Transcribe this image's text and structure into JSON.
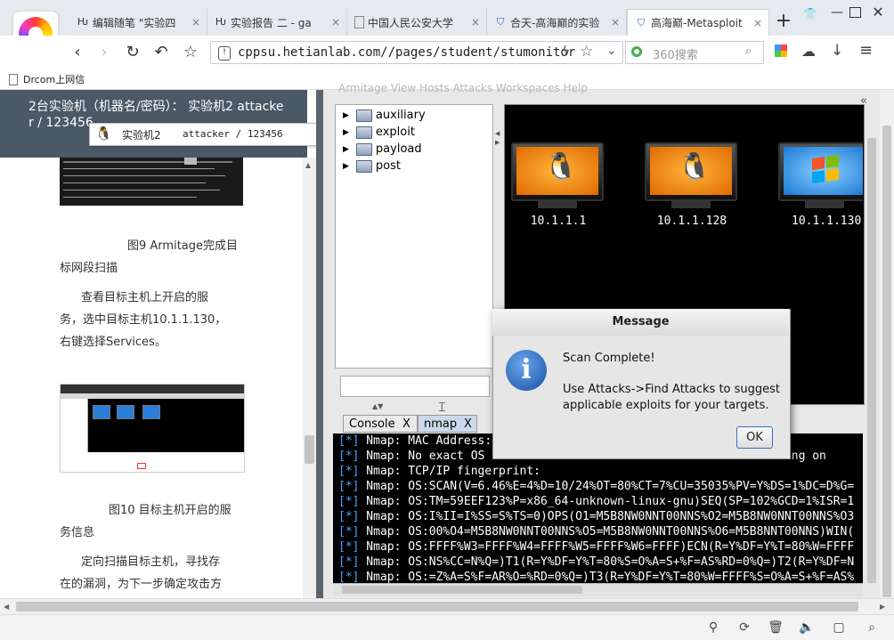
{
  "browser": {
    "tabs": [
      {
        "label": "编辑随笔 \"实验四",
        "icon": "h-logo-icon"
      },
      {
        "label": "实验报告 二 - ga",
        "icon": "h-logo-icon"
      },
      {
        "label": "中国人民公安大学",
        "icon": "page-icon"
      },
      {
        "label": "合天-高海巅的实验",
        "icon": "shield-icon"
      },
      {
        "label": "高海巅-Metasploit",
        "icon": "shield-icon"
      }
    ],
    "close_glyph": "×",
    "new_tab": "+",
    "url": "cppsu.hetianlab.com//pages/student/stumonitor",
    "search_placeholder": "360搜索",
    "bookmark": "Drcom上网信"
  },
  "doc": {
    "header_line1": "2台实验机（机器名/密码）： 实验机2    attacke",
    "header_line2": "r / 123456",
    "caption9_line1": "图9 Armitage完成目",
    "caption9_line2": "标网段扫描",
    "para1_line1": "查看目标主机上开启的服",
    "para1_line2": "务，选中目标主机10.1.1.130，",
    "para1_line3": "右键选择Services。",
    "caption10_line1": "图10 目标主机开启的服",
    "caption10_line2": "务信息",
    "para2_line1": "定向扫描目标主机，寻找存",
    "para2_line2": "在的漏洞，为下一步确定攻击方"
  },
  "popup": {
    "machine": "实验机2",
    "creds": "attacker / 123456"
  },
  "armitage": {
    "menu_faded": "Armitage  View  Hosts  Attacks  Workspaces  Help",
    "modules": [
      "auxiliary",
      "exploit",
      "payload",
      "post"
    ],
    "hosts": [
      {
        "ip": "10.1.1.1",
        "os": "linux"
      },
      {
        "ip": "10.1.1.128",
        "os": "linux"
      },
      {
        "ip": "10.1.1.130",
        "os": "windows"
      }
    ],
    "tabs": [
      {
        "label": "Console",
        "close": "X"
      },
      {
        "label": "nmap",
        "close": "X"
      }
    ],
    "console_lines": [
      {
        "prefix": "[*]",
        "text": " Nmap: MAC Address:"
      },
      {
        "prefix": "[*]",
        "text": " Nmap: No exact OS                                       running on"
      },
      {
        "prefix": "[*]",
        "text": " Nmap: TCP/IP fingerprint:"
      },
      {
        "prefix": "[*]",
        "text": " Nmap: OS:SCAN(V=6.46%E=4%D=10/24%OT=80%CT=7%CU=35035%PV=Y%DS=1%DC=D%G="
      },
      {
        "prefix": "[*]",
        "text": " Nmap: OS:TM=59EEF123%P=x86_64-unknown-linux-gnu)SEQ(SP=102%GCD=1%ISR=1"
      },
      {
        "prefix": "[*]",
        "text": " Nmap: OS:I%II=I%SS=S%TS=0)OPS(O1=M5B8NW0NNT00NNS%O2=M5B8NW0NNT00NNS%O3"
      },
      {
        "prefix": "[*]",
        "text": " Nmap: OS:00%O4=M5B8NW0NNT00NNS%O5=M5B8NW0NNT00NNS%O6=M5B8NNT00NNS)WIN("
      },
      {
        "prefix": "[*]",
        "text": " Nmap: OS:FFFF%W3=FFFF%W4=FFFF%W5=FFFF%W6=FFFF)ECN(R=Y%DF=Y%T=80%W=FFFF"
      },
      {
        "prefix": "[*]",
        "text": " Nmap: OS:NS%CC=N%Q=)T1(R=Y%DF=Y%T=80%S=O%A=S+%F=AS%RD=0%Q=)T2(R=Y%DF=N"
      },
      {
        "prefix": "[*]",
        "text": " Nmap: OS:=Z%A=S%F=AR%O=%RD=0%Q=)T3(R=Y%DF=Y%T=80%W=FFFF%S=O%A=S+%F=AS%"
      }
    ]
  },
  "dialog": {
    "title": "Message",
    "line1": "Scan Complete!",
    "line2": "Use Attacks->Find Attacks to suggest",
    "line3": "applicable exploits for your targets.",
    "ok": "OK"
  }
}
